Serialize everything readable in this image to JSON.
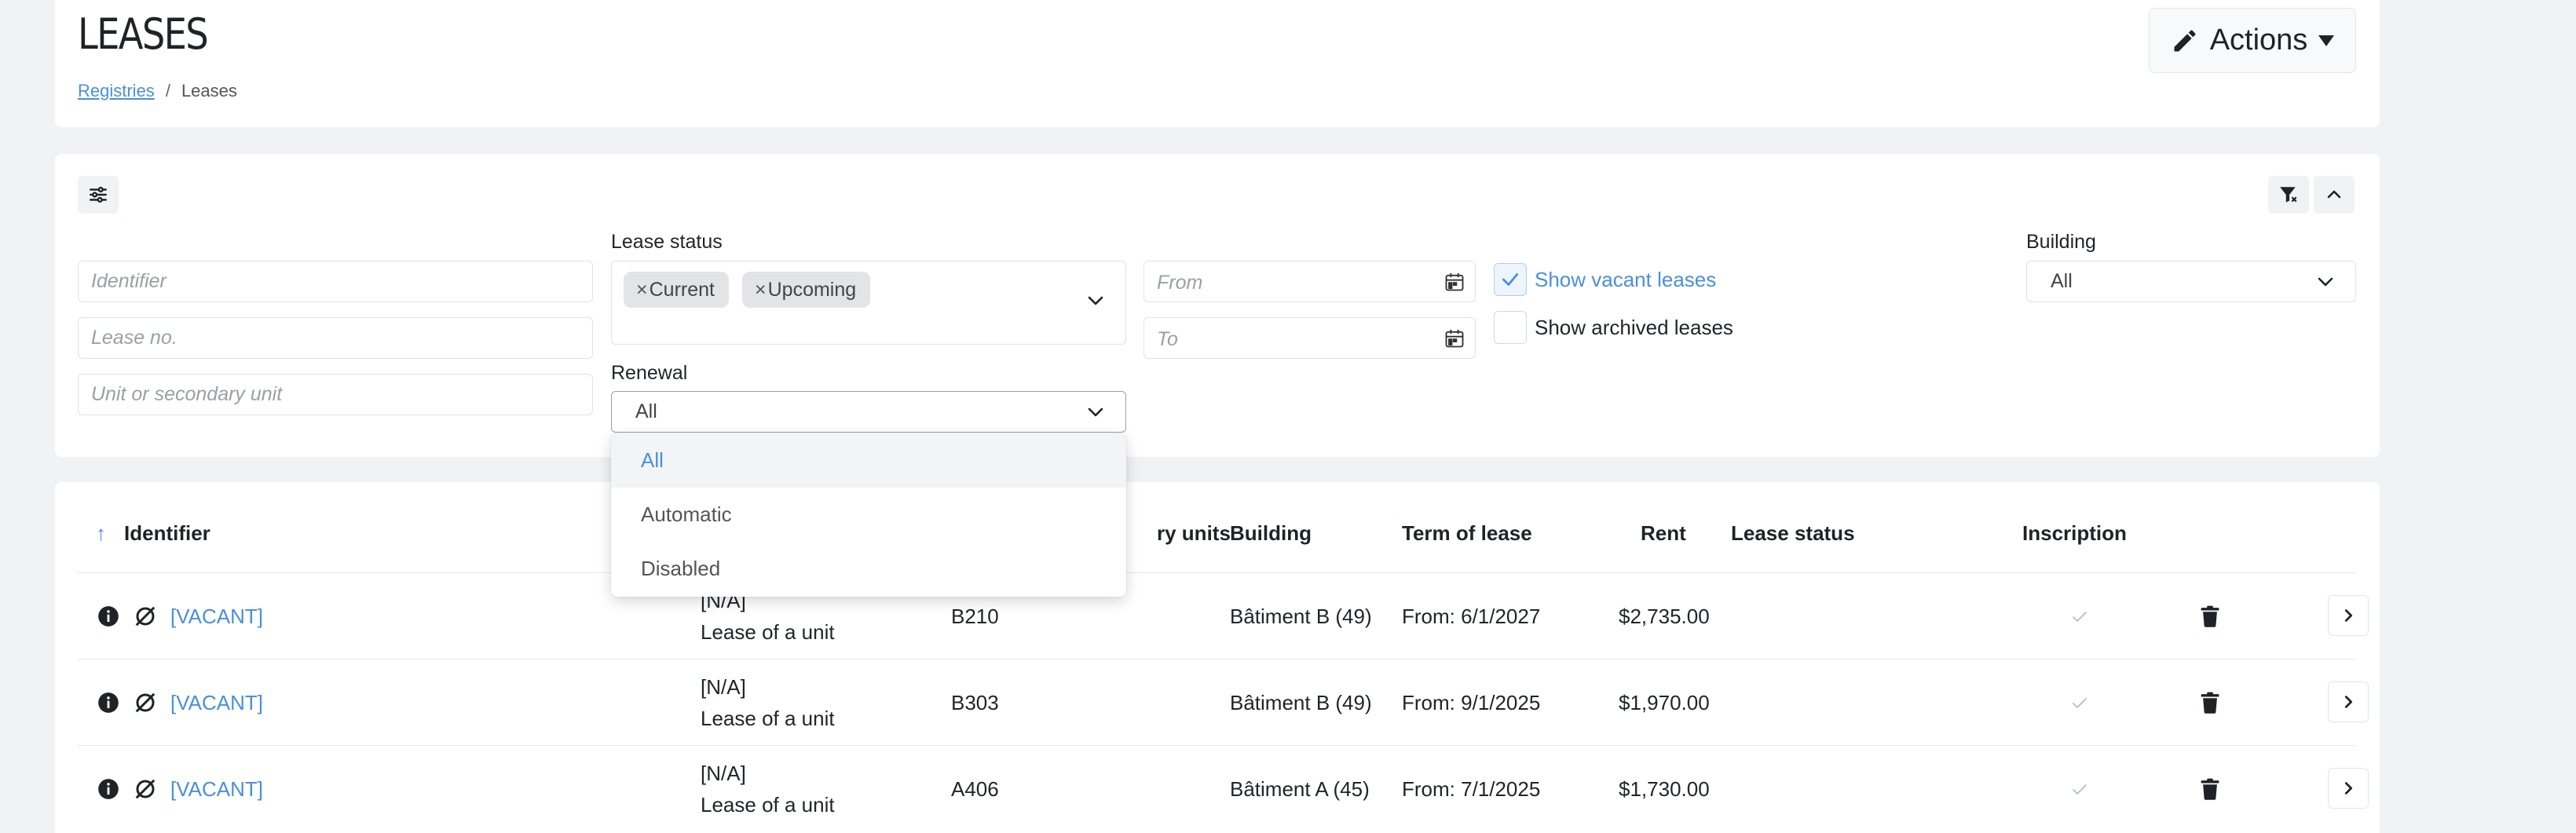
{
  "header": {
    "title": "LEASES",
    "breadcrumb": {
      "parent": "Registries",
      "separator": "/",
      "current": "Leases"
    },
    "actions_label": "Actions"
  },
  "filters": {
    "identifier_placeholder": "Identifier",
    "lease_no_placeholder": "Lease no.",
    "unit_placeholder": "Unit or secondary unit",
    "lease_status": {
      "label": "Lease status",
      "tags": [
        "Current",
        "Upcoming"
      ],
      "remove_glyph": "×"
    },
    "renewal": {
      "label": "Renewal",
      "value": "All",
      "options": [
        "All",
        "Automatic",
        "Disabled"
      ]
    },
    "from_placeholder": "From",
    "to_placeholder": "To",
    "show_vacant": {
      "label": "Show vacant leases",
      "checked": true
    },
    "show_archived": {
      "label": "Show archived leases",
      "checked": false
    },
    "building": {
      "label": "Building",
      "value": "All"
    }
  },
  "table": {
    "sort_arrow": "↑",
    "columns": {
      "identifier": "Identifier",
      "units_partial": "ry units",
      "building": "Building",
      "term": "Term of lease",
      "rent": "Rent",
      "status": "Lease status",
      "inscription": "Inscription"
    },
    "rows": [
      {
        "identifier": "[VACANT]",
        "tenant": "[N/A]",
        "type": "Lease of a unit",
        "unit": "B210",
        "building": "Bâtiment B (49)",
        "term": "From: 6/1/2027",
        "rent": "$2,735.00"
      },
      {
        "identifier": "[VACANT]",
        "tenant": "[N/A]",
        "type": "Lease of a unit",
        "unit": "B303",
        "building": "Bâtiment B (49)",
        "term": "From: 9/1/2025",
        "rent": "$1,970.00"
      },
      {
        "identifier": "[VACANT]",
        "tenant": "[N/A]",
        "type": "Lease of a unit",
        "unit": "A406",
        "building": "Bâtiment A (45)",
        "term": "From: 7/1/2025",
        "rent": "$1,730.00"
      }
    ]
  },
  "colors": {
    "link": "#4a8fdc",
    "background": "#f1f2f5"
  }
}
